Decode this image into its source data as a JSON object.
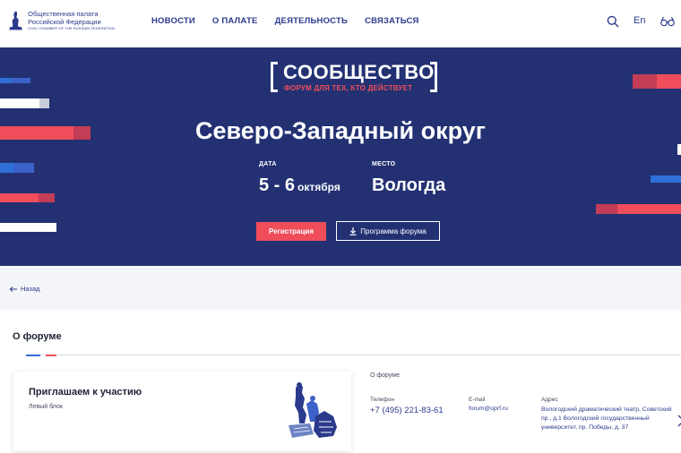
{
  "header": {
    "logo": {
      "line1": "Общественная палата",
      "line2": "Российской Федерации",
      "line3": "CIVIC CHAMBER OF THE RUSSIAN FEDERATION"
    },
    "nav": [
      {
        "label": "НОВОСТИ"
      },
      {
        "label": "О ПАЛАТЕ"
      },
      {
        "label": "ДЕЯТЕЛЬНОСТЬ"
      },
      {
        "label": "СВЯЗАТЬСЯ"
      }
    ],
    "lang_label": "En",
    "icons": [
      "search-icon",
      "glasses-icon"
    ]
  },
  "hero": {
    "brand_title": "СООБЩЕСТВО",
    "brand_subtitle": "ФОРУМ ДЛЯ ТЕХ, КТО ДЕЙСТВУЕТ",
    "title": "Северо-Западный округ",
    "date_label": "ДАТА",
    "date_days": "5 - 6",
    "date_month": "октября",
    "place_label": "МЕСТО",
    "place_value": "Вологда",
    "register_button": "Регистрация",
    "program_button": "Программа форума"
  },
  "back": {
    "label": "Назад"
  },
  "section": {
    "title": "О форуме"
  },
  "card": {
    "title": "Приглашаем к участию",
    "subtitle": "Левый блок"
  },
  "info": {
    "heading": "О форуме",
    "phone_label": "Телефон",
    "phone_value": "+7 (495) 221-83-61",
    "email_label": "E-mail",
    "email_value": "forum@oprf.ru",
    "address_label": "Адрес",
    "address_value": "Вологодский драматический театр, Советский пр., д.1 Вологодский государственный университет, пр. Победы, д. 37"
  },
  "colors": {
    "hero_bg": "#233173",
    "accent_red": "#ef4d5a",
    "accent_blue": "#2f6fd6",
    "text_navy": "#2b3a8c"
  }
}
